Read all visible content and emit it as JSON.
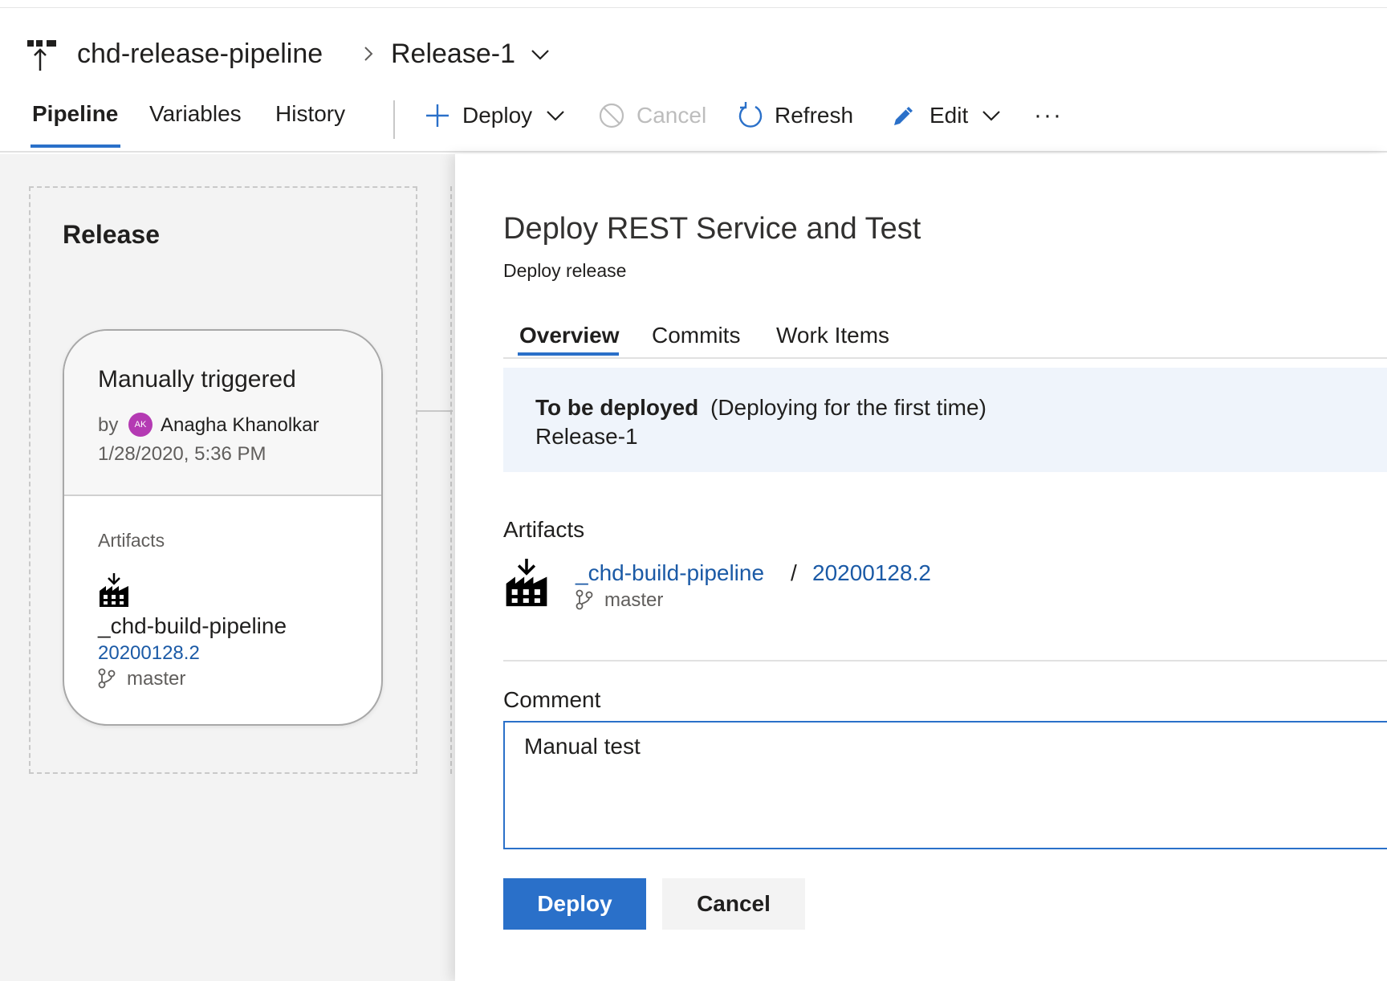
{
  "header": {
    "pipeline_name": "chd-release-pipeline",
    "release_name": "Release-1",
    "tabs": [
      {
        "label": "Pipeline",
        "active": true
      },
      {
        "label": "Variables",
        "active": false
      },
      {
        "label": "History",
        "active": false
      }
    ],
    "toolbar": {
      "deploy_label": "Deploy",
      "cancel_label": "Cancel",
      "refresh_label": "Refresh",
      "edit_label": "Edit",
      "more_label": "···"
    }
  },
  "canvas": {
    "stage_title": "Release",
    "trigger": {
      "title": "Manually triggered",
      "by_label": "by",
      "avatar_initials": "AK",
      "user": "Anagha Khanolkar",
      "date": "1/28/2020, 5:36 PM"
    },
    "artifacts_label": "Artifacts",
    "artifact": {
      "name": "_chd-build-pipeline",
      "version": "20200128.2",
      "branch": "master"
    }
  },
  "panel": {
    "title": "Deploy REST Service and Test",
    "subtitle": "Deploy release",
    "tabs": [
      {
        "label": "Overview",
        "active": true
      },
      {
        "label": "Commits",
        "active": false
      },
      {
        "label": "Work Items",
        "active": false
      }
    ],
    "info": {
      "strong": "To be deployed",
      "detail": "(Deploying for the first time)",
      "release": "Release-1"
    },
    "artifacts_label": "Artifacts",
    "artifact": {
      "name": "_chd-build-pipeline",
      "separator": "/",
      "version": "20200128.2",
      "branch": "master"
    },
    "comment_label": "Comment",
    "comment_value": "Manual test",
    "deploy_button": "Deploy",
    "cancel_button": "Cancel"
  },
  "colors": {
    "accent": "#2a70c9",
    "link": "#1b5aa6",
    "avatar": "#b43ab3",
    "info_bg": "#eff4fb"
  }
}
